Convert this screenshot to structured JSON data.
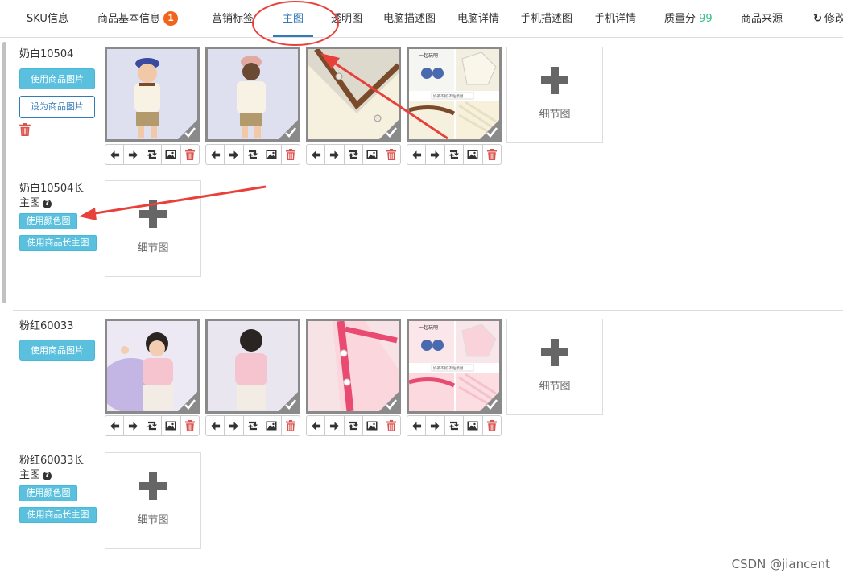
{
  "tabs": [
    {
      "label": "SKU信息"
    },
    {
      "label": "商品基本信息",
      "badge": "1"
    },
    {
      "label": "营销标签"
    },
    {
      "label": "主图",
      "active": true
    },
    {
      "label": "透明图"
    },
    {
      "label": "电脑描述图"
    },
    {
      "label": "电脑详情"
    },
    {
      "label": "手机描述图"
    },
    {
      "label": "手机详情"
    },
    {
      "label": "质量分",
      "score": "99"
    },
    {
      "label": "商品来源"
    },
    {
      "label": "修改"
    }
  ],
  "sku_groups": [
    {
      "name": "奶白10504",
      "use_product_images_label": "使用商品图片",
      "set_product_images_label": "设为商品图片",
      "add_label": "细节图",
      "long_name_line1": "奶白10504长",
      "long_name_line2": "主图",
      "use_color_image_label": "使用颜色图",
      "use_product_long_label": "使用商品长主图",
      "long_add_label": "细节图"
    },
    {
      "name": "粉红60033",
      "use_product_images_label": "使用商品图片",
      "add_label": "细节图",
      "long_name_line1": "粉红60033长",
      "long_name_line2": "主图",
      "use_color_image_label": "使用颜色图",
      "use_product_long_label": "使用商品长主图",
      "long_add_label": "细节图"
    }
  ],
  "image_card_text": {
    "top": "一起玩吧",
    "caption": "奶茶不腻 不粘摸顺"
  },
  "colors": {
    "accent": "#337ab7",
    "info_button": "#5bc0de",
    "badge": "#f0641c",
    "score": "#3cc08a",
    "annotation": "#e8413c",
    "danger": "#d9534f"
  },
  "watermark": "CSDN @jiancent"
}
